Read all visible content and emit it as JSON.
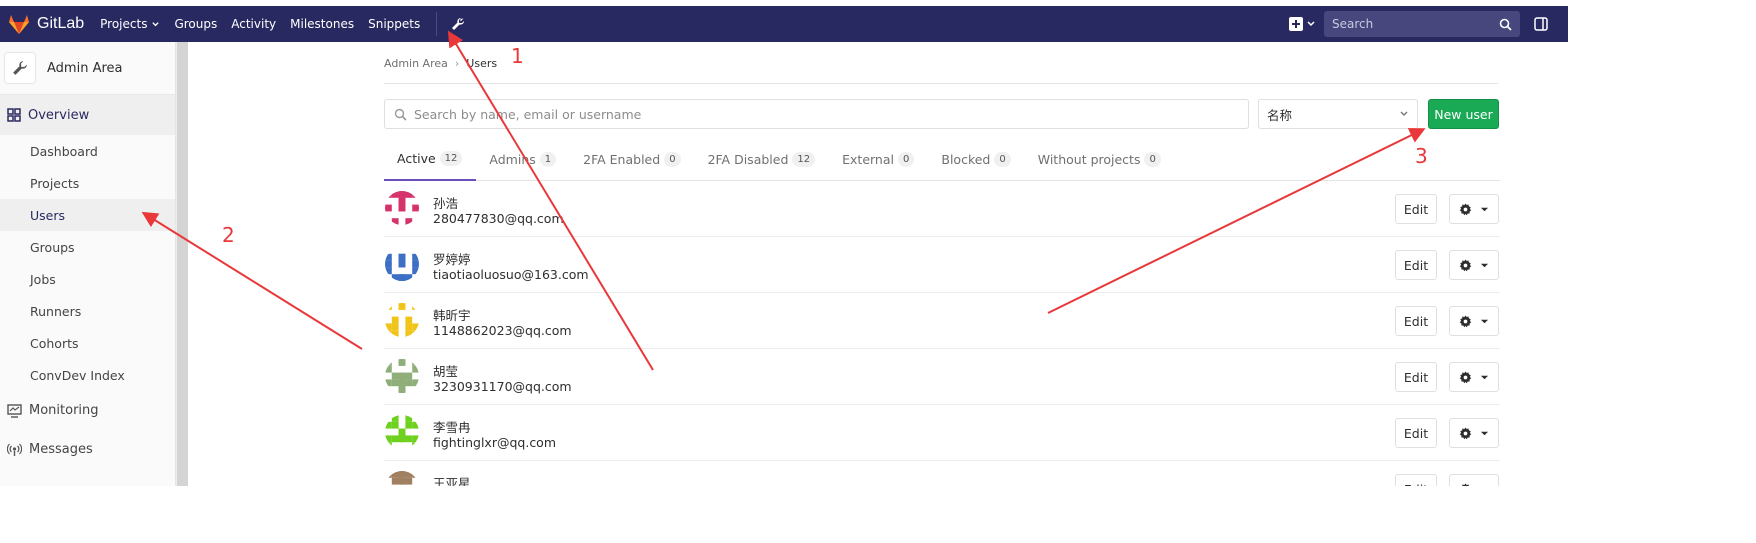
{
  "navbar": {
    "brand": "GitLab",
    "links": [
      {
        "label": "Projects",
        "has_dropdown": true
      },
      {
        "label": "Groups",
        "has_dropdown": false
      },
      {
        "label": "Activity",
        "has_dropdown": false
      },
      {
        "label": "Milestones",
        "has_dropdown": false
      },
      {
        "label": "Snippets",
        "has_dropdown": false
      }
    ],
    "admin_icon": "wrench-icon",
    "search_placeholder": "Search",
    "colors": {
      "navbar_bg": "#292961",
      "logo_orange": "#e24329"
    }
  },
  "sidebar": {
    "title": "Admin Area",
    "overview_label": "Overview",
    "items": [
      {
        "label": "Dashboard",
        "active": false
      },
      {
        "label": "Projects",
        "active": false
      },
      {
        "label": "Users",
        "active": true
      },
      {
        "label": "Groups",
        "active": false
      },
      {
        "label": "Jobs",
        "active": false
      },
      {
        "label": "Runners",
        "active": false
      },
      {
        "label": "Cohorts",
        "active": false
      },
      {
        "label": "ConvDev Index",
        "active": false
      }
    ],
    "monitoring_label": "Monitoring",
    "messages_label": "Messages"
  },
  "breadcrumb": {
    "root": "Admin Area",
    "current": "Users"
  },
  "search": {
    "placeholder": "Search by name, email or username"
  },
  "sort": {
    "selected": "名称"
  },
  "new_user_label": "New user",
  "tabs": [
    {
      "label": "Active",
      "count": "12",
      "active": true
    },
    {
      "label": "Admins",
      "count": "1",
      "active": false
    },
    {
      "label": "2FA Enabled",
      "count": "0",
      "active": false
    },
    {
      "label": "2FA Disabled",
      "count": "12",
      "active": false
    },
    {
      "label": "External",
      "count": "0",
      "active": false
    },
    {
      "label": "Blocked",
      "count": "0",
      "active": false
    },
    {
      "label": "Without projects",
      "count": "0",
      "active": false
    }
  ],
  "users": [
    {
      "name": "孙浩",
      "email": "280477830@qq.com",
      "avatar_color": "#d6336c"
    },
    {
      "name": "罗婷婷",
      "email": "tiaotiaoluosuo@163.com",
      "avatar_color": "#3d6fc4"
    },
    {
      "name": "韩昕宇",
      "email": "1148862023@qq.com",
      "avatar_color": "#f0c419"
    },
    {
      "name": "胡莹",
      "email": "3230931170@qq.com",
      "avatar_color": "#8fae7a"
    },
    {
      "name": "李雪冉",
      "email": "fightinglxr@qq.com",
      "avatar_color": "#6fd11f"
    },
    {
      "name": "王亚星",
      "email": "",
      "avatar_color": "#a08060"
    }
  ],
  "row_actions": {
    "edit_label": "Edit"
  },
  "annotations": [
    {
      "number": "1"
    },
    {
      "number": "2"
    },
    {
      "number": "3"
    }
  ]
}
